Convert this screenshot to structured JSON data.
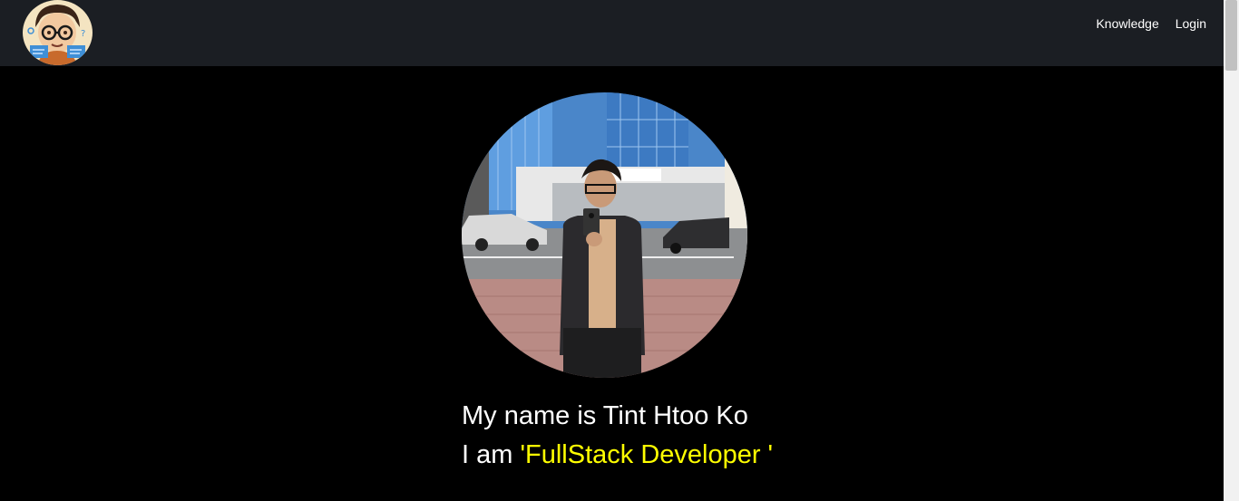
{
  "nav": {
    "links": [
      {
        "label": "Knowledge"
      },
      {
        "label": "Login"
      }
    ]
  },
  "hero": {
    "name_line": "My name is Tint Htoo Ko",
    "role_prefix": "I am ",
    "role_text": "'FullStack Developer '"
  },
  "colors": {
    "navbar_bg": "#1b1e23",
    "page_bg": "#000000",
    "highlight": "#ffff00"
  },
  "icons": {
    "logo": "developer-avatar-logo"
  }
}
